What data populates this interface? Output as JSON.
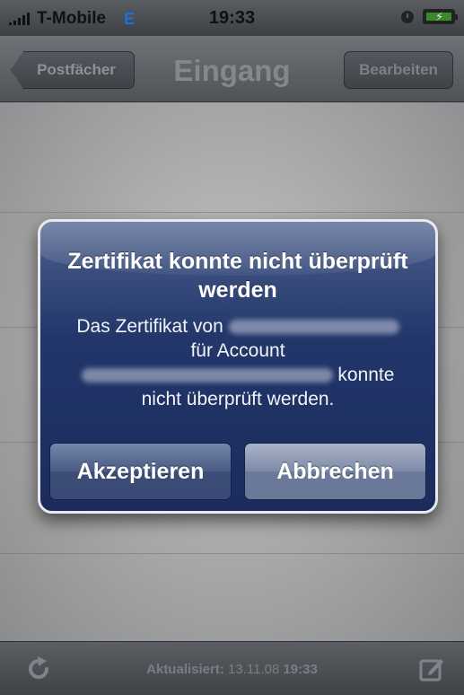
{
  "status_bar": {
    "carrier": "T-Mobile",
    "network": "E",
    "time": "19:33"
  },
  "navbar": {
    "back_label": "Postfächer",
    "title": "Eingang",
    "edit_label": "Bearbeiten"
  },
  "alert": {
    "title": "Zertifikat konnte nicht überprüft werden",
    "msg_part1": "Das Zertifikat von",
    "msg_part2": "für Account",
    "msg_part3": "konnte",
    "msg_part4": "nicht überprüft werden.",
    "accept_label": "Akzeptieren",
    "cancel_label": "Abbrechen"
  },
  "toolbar": {
    "updated_label": "Aktualisiert:",
    "updated_date": "13.11.08",
    "updated_time": "19:33"
  },
  "icons": {
    "refresh": "refresh-icon",
    "compose": "compose-icon",
    "alarm": "alarm-clock-icon",
    "battery": "battery-charging-icon"
  }
}
